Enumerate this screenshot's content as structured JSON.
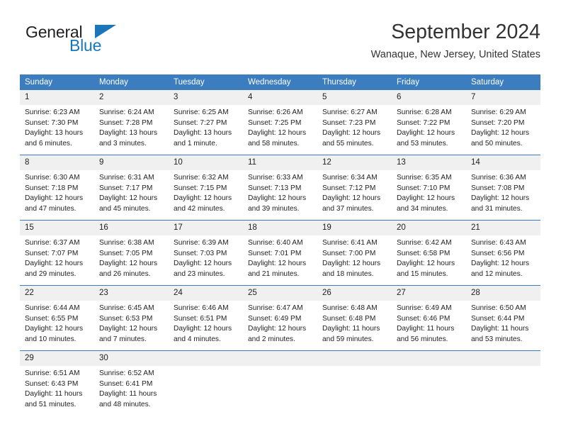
{
  "brand": {
    "name_part1": "General",
    "name_part2": "Blue",
    "triangle_icon": "brand-triangle-icon",
    "colors": {
      "dark": "#231f20",
      "blue": "#1b75bb"
    }
  },
  "header": {
    "title": "September 2024",
    "subtitle": "Wanaque, New Jersey, United States"
  },
  "theme": {
    "header_row_bg": "#3b7dbf",
    "daynum_bg": "#f0f0f0",
    "row_divider": "#3b7dbf",
    "text": "#222222"
  },
  "weekday_headers": [
    "Sunday",
    "Monday",
    "Tuesday",
    "Wednesday",
    "Thursday",
    "Friday",
    "Saturday"
  ],
  "weeks": [
    [
      {
        "day": "1",
        "sunrise": "Sunrise: 6:23 AM",
        "sunset": "Sunset: 7:30 PM",
        "daylight1": "Daylight: 13 hours",
        "daylight2": "and 6 minutes."
      },
      {
        "day": "2",
        "sunrise": "Sunrise: 6:24 AM",
        "sunset": "Sunset: 7:28 PM",
        "daylight1": "Daylight: 13 hours",
        "daylight2": "and 3 minutes."
      },
      {
        "day": "3",
        "sunrise": "Sunrise: 6:25 AM",
        "sunset": "Sunset: 7:27 PM",
        "daylight1": "Daylight: 13 hours",
        "daylight2": "and 1 minute."
      },
      {
        "day": "4",
        "sunrise": "Sunrise: 6:26 AM",
        "sunset": "Sunset: 7:25 PM",
        "daylight1": "Daylight: 12 hours",
        "daylight2": "and 58 minutes."
      },
      {
        "day": "5",
        "sunrise": "Sunrise: 6:27 AM",
        "sunset": "Sunset: 7:23 PM",
        "daylight1": "Daylight: 12 hours",
        "daylight2": "and 55 minutes."
      },
      {
        "day": "6",
        "sunrise": "Sunrise: 6:28 AM",
        "sunset": "Sunset: 7:22 PM",
        "daylight1": "Daylight: 12 hours",
        "daylight2": "and 53 minutes."
      },
      {
        "day": "7",
        "sunrise": "Sunrise: 6:29 AM",
        "sunset": "Sunset: 7:20 PM",
        "daylight1": "Daylight: 12 hours",
        "daylight2": "and 50 minutes."
      }
    ],
    [
      {
        "day": "8",
        "sunrise": "Sunrise: 6:30 AM",
        "sunset": "Sunset: 7:18 PM",
        "daylight1": "Daylight: 12 hours",
        "daylight2": "and 47 minutes."
      },
      {
        "day": "9",
        "sunrise": "Sunrise: 6:31 AM",
        "sunset": "Sunset: 7:17 PM",
        "daylight1": "Daylight: 12 hours",
        "daylight2": "and 45 minutes."
      },
      {
        "day": "10",
        "sunrise": "Sunrise: 6:32 AM",
        "sunset": "Sunset: 7:15 PM",
        "daylight1": "Daylight: 12 hours",
        "daylight2": "and 42 minutes."
      },
      {
        "day": "11",
        "sunrise": "Sunrise: 6:33 AM",
        "sunset": "Sunset: 7:13 PM",
        "daylight1": "Daylight: 12 hours",
        "daylight2": "and 39 minutes."
      },
      {
        "day": "12",
        "sunrise": "Sunrise: 6:34 AM",
        "sunset": "Sunset: 7:12 PM",
        "daylight1": "Daylight: 12 hours",
        "daylight2": "and 37 minutes."
      },
      {
        "day": "13",
        "sunrise": "Sunrise: 6:35 AM",
        "sunset": "Sunset: 7:10 PM",
        "daylight1": "Daylight: 12 hours",
        "daylight2": "and 34 minutes."
      },
      {
        "day": "14",
        "sunrise": "Sunrise: 6:36 AM",
        "sunset": "Sunset: 7:08 PM",
        "daylight1": "Daylight: 12 hours",
        "daylight2": "and 31 minutes."
      }
    ],
    [
      {
        "day": "15",
        "sunrise": "Sunrise: 6:37 AM",
        "sunset": "Sunset: 7:07 PM",
        "daylight1": "Daylight: 12 hours",
        "daylight2": "and 29 minutes."
      },
      {
        "day": "16",
        "sunrise": "Sunrise: 6:38 AM",
        "sunset": "Sunset: 7:05 PM",
        "daylight1": "Daylight: 12 hours",
        "daylight2": "and 26 minutes."
      },
      {
        "day": "17",
        "sunrise": "Sunrise: 6:39 AM",
        "sunset": "Sunset: 7:03 PM",
        "daylight1": "Daylight: 12 hours",
        "daylight2": "and 23 minutes."
      },
      {
        "day": "18",
        "sunrise": "Sunrise: 6:40 AM",
        "sunset": "Sunset: 7:01 PM",
        "daylight1": "Daylight: 12 hours",
        "daylight2": "and 21 minutes."
      },
      {
        "day": "19",
        "sunrise": "Sunrise: 6:41 AM",
        "sunset": "Sunset: 7:00 PM",
        "daylight1": "Daylight: 12 hours",
        "daylight2": "and 18 minutes."
      },
      {
        "day": "20",
        "sunrise": "Sunrise: 6:42 AM",
        "sunset": "Sunset: 6:58 PM",
        "daylight1": "Daylight: 12 hours",
        "daylight2": "and 15 minutes."
      },
      {
        "day": "21",
        "sunrise": "Sunrise: 6:43 AM",
        "sunset": "Sunset: 6:56 PM",
        "daylight1": "Daylight: 12 hours",
        "daylight2": "and 12 minutes."
      }
    ],
    [
      {
        "day": "22",
        "sunrise": "Sunrise: 6:44 AM",
        "sunset": "Sunset: 6:55 PM",
        "daylight1": "Daylight: 12 hours",
        "daylight2": "and 10 minutes."
      },
      {
        "day": "23",
        "sunrise": "Sunrise: 6:45 AM",
        "sunset": "Sunset: 6:53 PM",
        "daylight1": "Daylight: 12 hours",
        "daylight2": "and 7 minutes."
      },
      {
        "day": "24",
        "sunrise": "Sunrise: 6:46 AM",
        "sunset": "Sunset: 6:51 PM",
        "daylight1": "Daylight: 12 hours",
        "daylight2": "and 4 minutes."
      },
      {
        "day": "25",
        "sunrise": "Sunrise: 6:47 AM",
        "sunset": "Sunset: 6:49 PM",
        "daylight1": "Daylight: 12 hours",
        "daylight2": "and 2 minutes."
      },
      {
        "day": "26",
        "sunrise": "Sunrise: 6:48 AM",
        "sunset": "Sunset: 6:48 PM",
        "daylight1": "Daylight: 11 hours",
        "daylight2": "and 59 minutes."
      },
      {
        "day": "27",
        "sunrise": "Sunrise: 6:49 AM",
        "sunset": "Sunset: 6:46 PM",
        "daylight1": "Daylight: 11 hours",
        "daylight2": "and 56 minutes."
      },
      {
        "day": "28",
        "sunrise": "Sunrise: 6:50 AM",
        "sunset": "Sunset: 6:44 PM",
        "daylight1": "Daylight: 11 hours",
        "daylight2": "and 53 minutes."
      }
    ],
    [
      {
        "day": "29",
        "sunrise": "Sunrise: 6:51 AM",
        "sunset": "Sunset: 6:43 PM",
        "daylight1": "Daylight: 11 hours",
        "daylight2": "and 51 minutes."
      },
      {
        "day": "30",
        "sunrise": "Sunrise: 6:52 AM",
        "sunset": "Sunset: 6:41 PM",
        "daylight1": "Daylight: 11 hours",
        "daylight2": "and 48 minutes."
      },
      {
        "day": "",
        "sunrise": "",
        "sunset": "",
        "daylight1": "",
        "daylight2": ""
      },
      {
        "day": "",
        "sunrise": "",
        "sunset": "",
        "daylight1": "",
        "daylight2": ""
      },
      {
        "day": "",
        "sunrise": "",
        "sunset": "",
        "daylight1": "",
        "daylight2": ""
      },
      {
        "day": "",
        "sunrise": "",
        "sunset": "",
        "daylight1": "",
        "daylight2": ""
      },
      {
        "day": "",
        "sunrise": "",
        "sunset": "",
        "daylight1": "",
        "daylight2": ""
      }
    ]
  ]
}
